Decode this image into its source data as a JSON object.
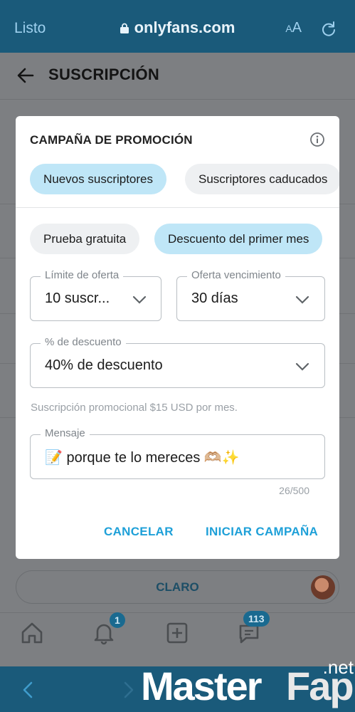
{
  "browser": {
    "done_label": "Listo",
    "url": "onlyfans.com",
    "text_size_label_small": "A",
    "text_size_label_large": "A"
  },
  "page": {
    "title": "SUSCRIPCIÓN",
    "claro_label": "CLARO"
  },
  "tabbar": {
    "notifications_count": "1",
    "messages_count": "113"
  },
  "modal": {
    "title": "CAMPAÑA DE PROMOCIÓN",
    "audience_chips": [
      {
        "label": "Nuevos suscriptores",
        "active": true
      },
      {
        "label": "Suscriptores caducados",
        "active": false
      }
    ],
    "type_chips": [
      {
        "label": "Prueba gratuita",
        "active": false
      },
      {
        "label": "Descuento del primer mes",
        "active": true
      }
    ],
    "offer_limit": {
      "label": "Límite de oferta",
      "value": "10 suscr..."
    },
    "offer_expiration": {
      "label": "Oferta vencimiento",
      "value": "30 días"
    },
    "discount": {
      "label": "% de descuento",
      "value": "40% de descuento"
    },
    "helper_text": "Suscripción promocional $15 USD por mes.",
    "message": {
      "label": "Mensaje",
      "value": "📝 porque te lo mereces 🫶🏼✨"
    },
    "char_counter": "26/500",
    "cancel_label": "CANCELAR",
    "start_label": "INICIAR CAMPAÑA"
  },
  "watermark": {
    "part1": "Master",
    "part2": "Fap",
    "part3": ".net"
  },
  "colors": {
    "accent": "#1ea0d8",
    "chip_active": "#bfe6f7",
    "browser_bar": "#1a5a7a"
  }
}
